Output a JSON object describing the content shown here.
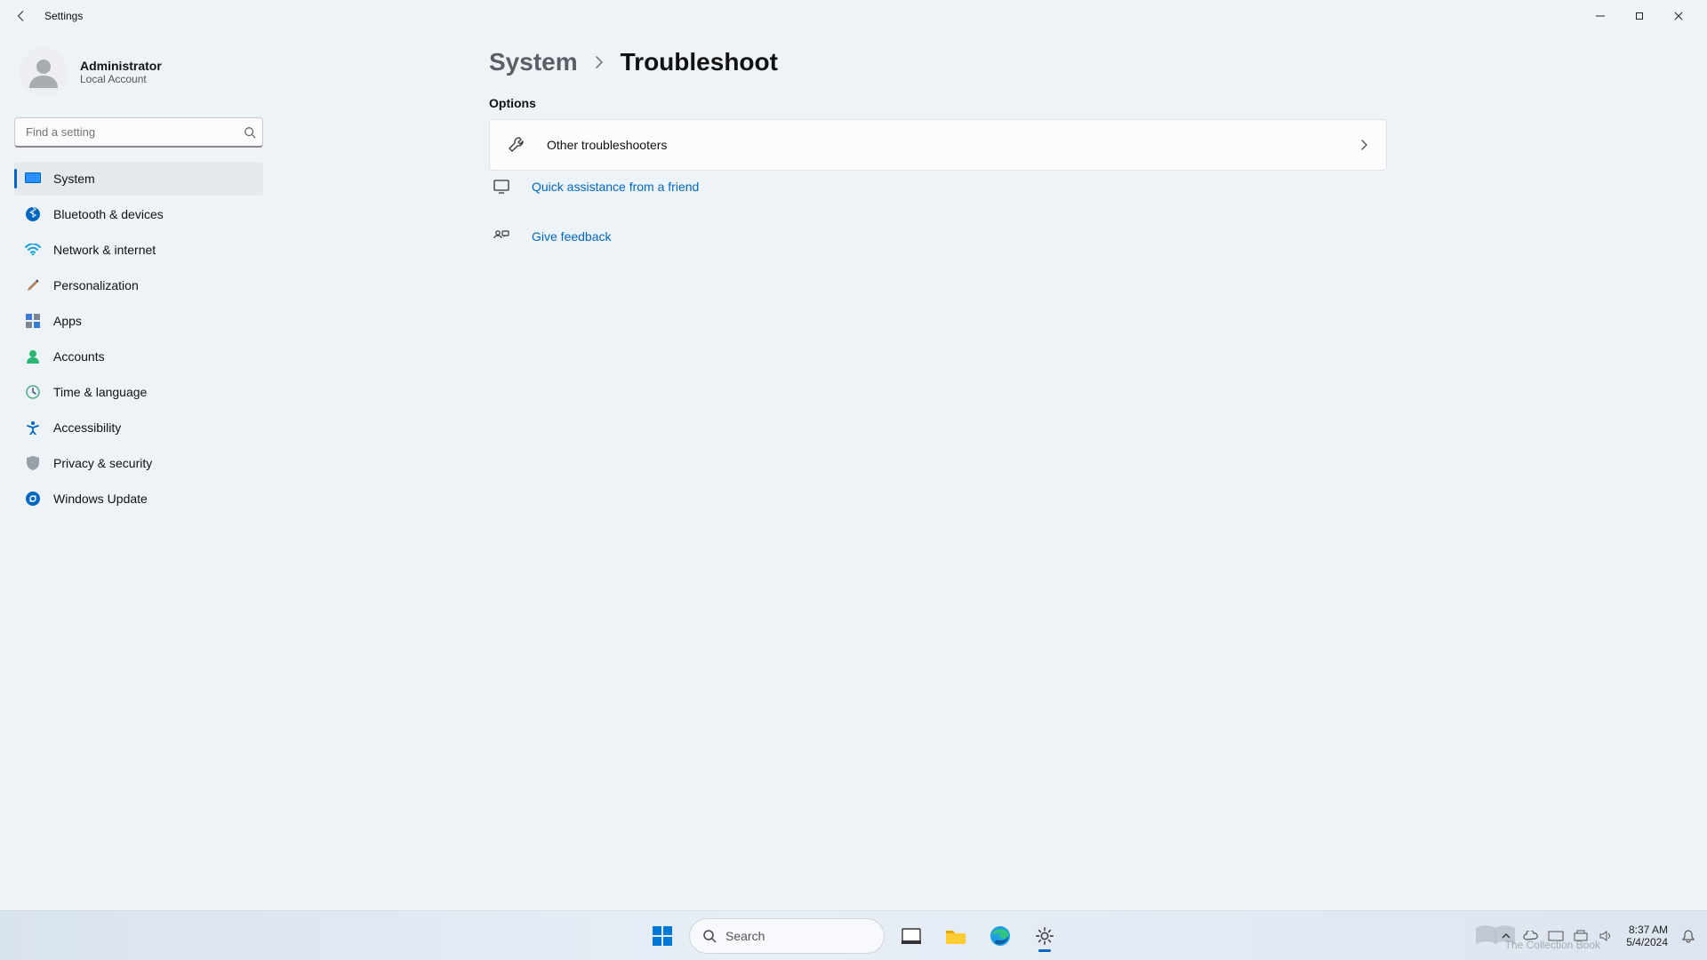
{
  "window": {
    "title": "Settings"
  },
  "profile": {
    "name": "Administrator",
    "subtitle": "Local Account"
  },
  "search": {
    "placeholder": "Find a setting"
  },
  "nav": {
    "items": [
      {
        "label": "System"
      },
      {
        "label": "Bluetooth & devices"
      },
      {
        "label": "Network & internet"
      },
      {
        "label": "Personalization"
      },
      {
        "label": "Apps"
      },
      {
        "label": "Accounts"
      },
      {
        "label": "Time & language"
      },
      {
        "label": "Accessibility"
      },
      {
        "label": "Privacy & security"
      },
      {
        "label": "Windows Update"
      }
    ]
  },
  "breadcrumb": {
    "parent": "System",
    "current": "Troubleshoot"
  },
  "section": {
    "options": "Options"
  },
  "cards": {
    "other_troubleshooters": "Other troubleshooters"
  },
  "links": {
    "quick_assistance": "Quick assistance from a friend",
    "give_feedback": "Give feedback"
  },
  "taskbar": {
    "search": "Search"
  },
  "clock": {
    "time": "8:37 AM",
    "date": "5/4/2024"
  },
  "watermark": {
    "text": "The Collection Book"
  }
}
